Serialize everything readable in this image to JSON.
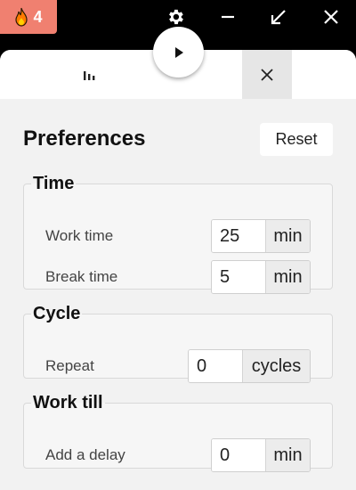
{
  "titlebar": {
    "streak_count": "4",
    "colors": {
      "streak_bg": "#f08070",
      "bar_bg": "#000000"
    },
    "icons": [
      "flame-icon",
      "gear-icon",
      "minimize-icon",
      "restore-icon",
      "close-icon"
    ]
  },
  "play": {
    "icon": "play-icon"
  },
  "tabs": {
    "stats_icon": "bar-chart-icon",
    "close_icon": "close-icon"
  },
  "preferences": {
    "title": "Preferences",
    "reset_label": "Reset",
    "time": {
      "legend": "Time",
      "work_label": "Work time",
      "work_value": "25",
      "work_unit": "min",
      "break_label": "Break time",
      "break_value": "5",
      "break_unit": "min"
    },
    "cycle": {
      "legend": "Cycle",
      "repeat_label": "Repeat",
      "repeat_value": "0",
      "repeat_unit": "cycles"
    },
    "work_till": {
      "legend": "Work till",
      "delay_label": "Add a delay",
      "delay_value": "0",
      "delay_unit": "min"
    }
  }
}
